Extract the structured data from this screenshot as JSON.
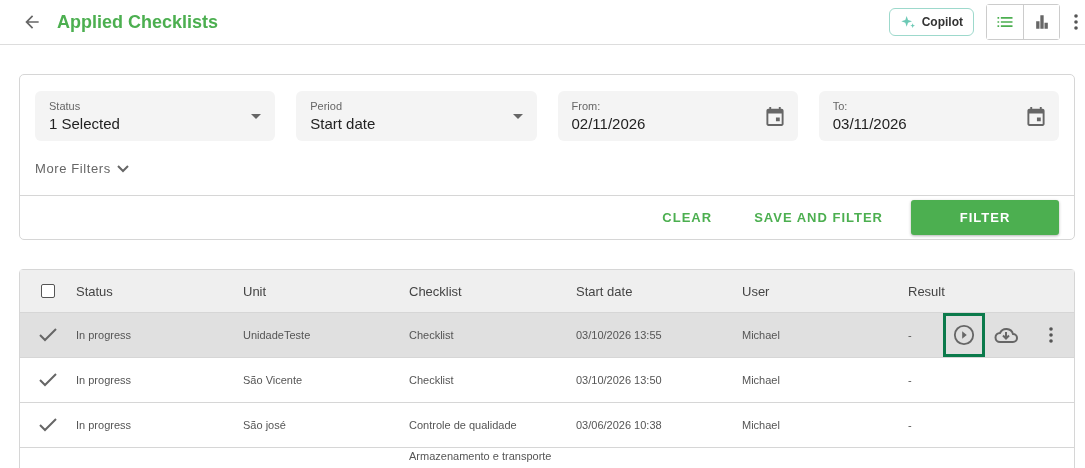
{
  "header": {
    "title": "Applied Checklists",
    "copilot": "Copilot",
    "views": [
      {
        "kind": "list",
        "selected": true
      },
      {
        "kind": "chart",
        "selected": false
      }
    ]
  },
  "filters": {
    "fields": [
      {
        "kind": "select",
        "label": "Status",
        "value": "1 Selected"
      },
      {
        "kind": "select",
        "label": "Period",
        "value": "Start date"
      },
      {
        "kind": "date",
        "label": "From:",
        "value": "02/11/2026"
      },
      {
        "kind": "date",
        "label": "To:",
        "value": "03/11/2026"
      }
    ],
    "more": "More Filters",
    "clear": "CLEAR",
    "save": "SAVE AND FILTER",
    "filter": "FILTER"
  },
  "table": {
    "all_checked": false,
    "columns": [
      "Status",
      "Unit",
      "Checklist",
      "Start date",
      "User",
      "Result"
    ],
    "rows": [
      {
        "selected": true,
        "show_actions": true,
        "play_focused": true,
        "cells": [
          "In progress",
          "UnidadeTeste",
          "Checklist",
          "03/10/2026 13:55",
          "Michael",
          "-"
        ]
      },
      {
        "selected": false,
        "show_actions": false,
        "cells": [
          "In progress",
          "São Vicente",
          "Checklist",
          "03/10/2026 13:50",
          "Michael",
          "-"
        ]
      },
      {
        "selected": false,
        "show_actions": false,
        "cells": [
          "In progress",
          "São josé",
          "Controle de qualidade",
          "03/06/2026 10:38",
          "Michael",
          "-"
        ]
      },
      {
        "selected": false,
        "show_actions": false,
        "cells": [
          "",
          "",
          "Armazenamento e transporte",
          "",
          "",
          ""
        ]
      }
    ]
  }
}
